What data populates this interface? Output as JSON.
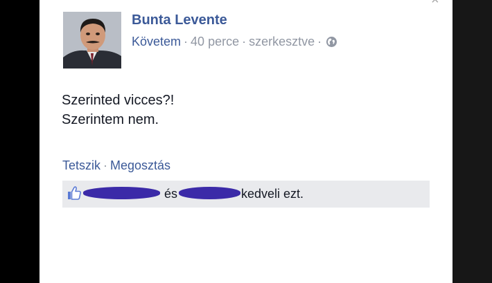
{
  "post": {
    "author": "Bunta Levente",
    "follow_label": "Követem",
    "time": "40 perce",
    "edited": "szerkesztve",
    "audience_icon": "globe-icon",
    "text_lines": [
      "Szerinted vicces?!",
      "Szerintem nem."
    ]
  },
  "actions": {
    "like": "Tetszik",
    "share": "Megosztás"
  },
  "likes": {
    "icon": "thumbs-up-icon",
    "conjunction": "és",
    "suffix": "kedveli ezt."
  },
  "colors": {
    "link_blue": "#3b5998",
    "meta_gray": "#9197a3",
    "likes_background": "#e9eaed",
    "redaction": "#3b2aa8"
  }
}
